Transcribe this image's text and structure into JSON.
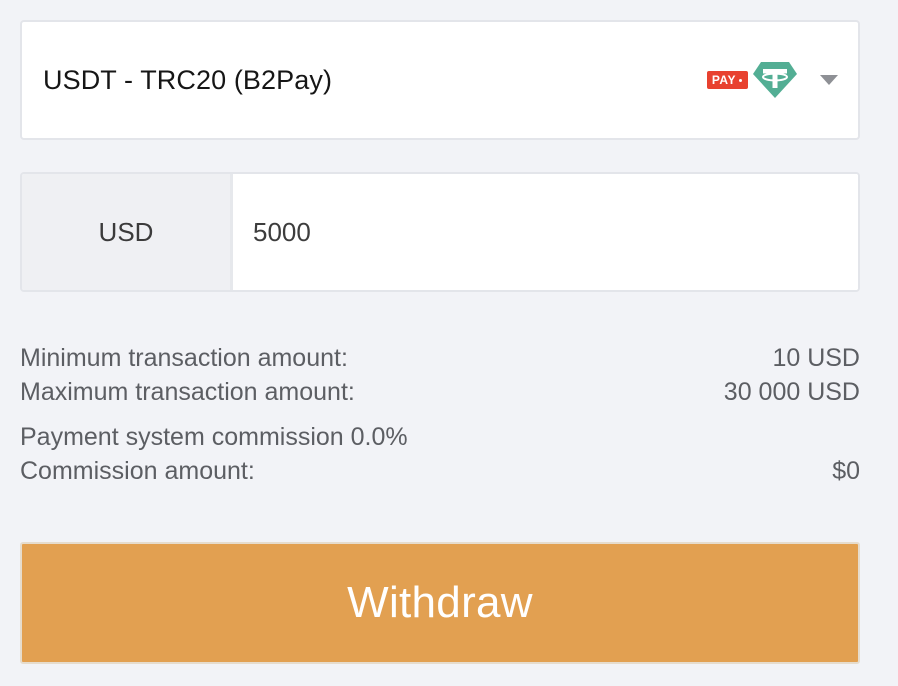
{
  "payment_method": {
    "label": "USDT - TRC20 (B2Pay)",
    "badge_text": "PAY",
    "icons": [
      "pay-badge-icon",
      "tether-icon",
      "chevron-down-icon"
    ],
    "badge_color": "#e8412f",
    "tether_color": "#53ae94"
  },
  "amount": {
    "currency": "USD",
    "value": "5000"
  },
  "limits": {
    "min_label": "Minimum transaction amount:",
    "min_value": "10 USD",
    "max_label": "Maximum transaction amount:",
    "max_value": "30 000 USD"
  },
  "commission": {
    "rate_label": "Payment system commission 0.0%",
    "amount_label": "Commission amount:",
    "amount_value": "$0"
  },
  "actions": {
    "withdraw_label": "Withdraw",
    "withdraw_color": "#e2a051"
  }
}
